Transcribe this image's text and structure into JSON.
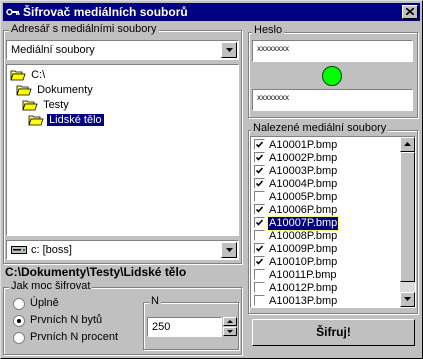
{
  "window": {
    "title": "Šifrovač mediálních souborů"
  },
  "left": {
    "dir_group_label": "Adresář s mediálními soubory",
    "filter_value": "Mediální soubory",
    "tree": [
      {
        "label": "C:\\",
        "open": true
      },
      {
        "label": "Dokumenty",
        "open": true
      },
      {
        "label": "Testy",
        "open": true
      },
      {
        "label": "Lidské tělo",
        "open": true,
        "selected": true
      }
    ],
    "drive_value": "c: [boss]",
    "current_path": "C:\\Dokumenty\\Testy\\Lidské tělo"
  },
  "strength": {
    "group_label": "Jak moc šifrovat",
    "options": [
      "Úplně",
      "Prvních N bytů",
      "Prvních N procent"
    ],
    "selected_index": 1,
    "n_label": "N",
    "n_value": "250"
  },
  "password": {
    "group_label": "Heslo",
    "field1": "xxxxxxxx",
    "field2": "xxxxxxxx",
    "status_color": "#00ff00"
  },
  "files": {
    "group_label": "Nalezené mediální soubory",
    "items": [
      {
        "name": "A10001P.bmp",
        "checked": true
      },
      {
        "name": "A10002P.bmp",
        "checked": true
      },
      {
        "name": "A10003P.bmp",
        "checked": true
      },
      {
        "name": "A10004P.bmp",
        "checked": true
      },
      {
        "name": "A10005P.bmp",
        "checked": false
      },
      {
        "name": "A10006P.bmp",
        "checked": true
      },
      {
        "name": "A10007P.bmp",
        "checked": true,
        "selected": true
      },
      {
        "name": "A10008P.bmp",
        "checked": false
      },
      {
        "name": "A10009P.bmp",
        "checked": true
      },
      {
        "name": "A10010P.bmp",
        "checked": true
      },
      {
        "name": "A10011P.bmp",
        "checked": false
      },
      {
        "name": "A10012P.bmp",
        "checked": false
      },
      {
        "name": "A10013P.bmp",
        "checked": false
      }
    ]
  },
  "actions": {
    "encrypt_label": "Šifruj!"
  },
  "colors": {
    "titlebar": "#000080",
    "face": "#c0c0c0",
    "selection": "#000080"
  }
}
